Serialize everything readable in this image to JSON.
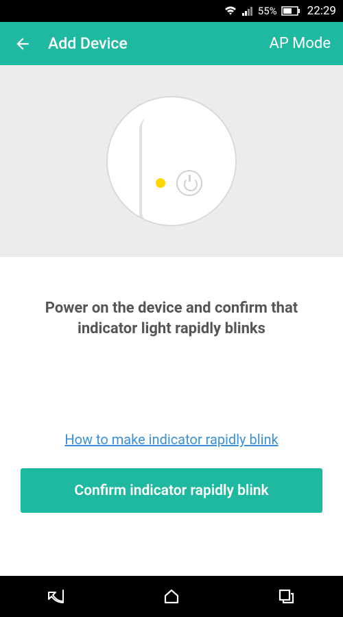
{
  "status_bar": {
    "battery_text": "55%",
    "time": "22:29"
  },
  "app_bar": {
    "title": "Add Device",
    "mode_label": "AP Mode"
  },
  "content": {
    "instruction": "Power on the device and confirm that indicator light rapidly blinks",
    "help_link": "How to make indicator rapidly blink",
    "confirm_button": "Confirm indicator rapidly blink"
  },
  "colors": {
    "accent": "#1fb8a0",
    "link": "#3b8fd6",
    "indicator": "#ffd500"
  }
}
